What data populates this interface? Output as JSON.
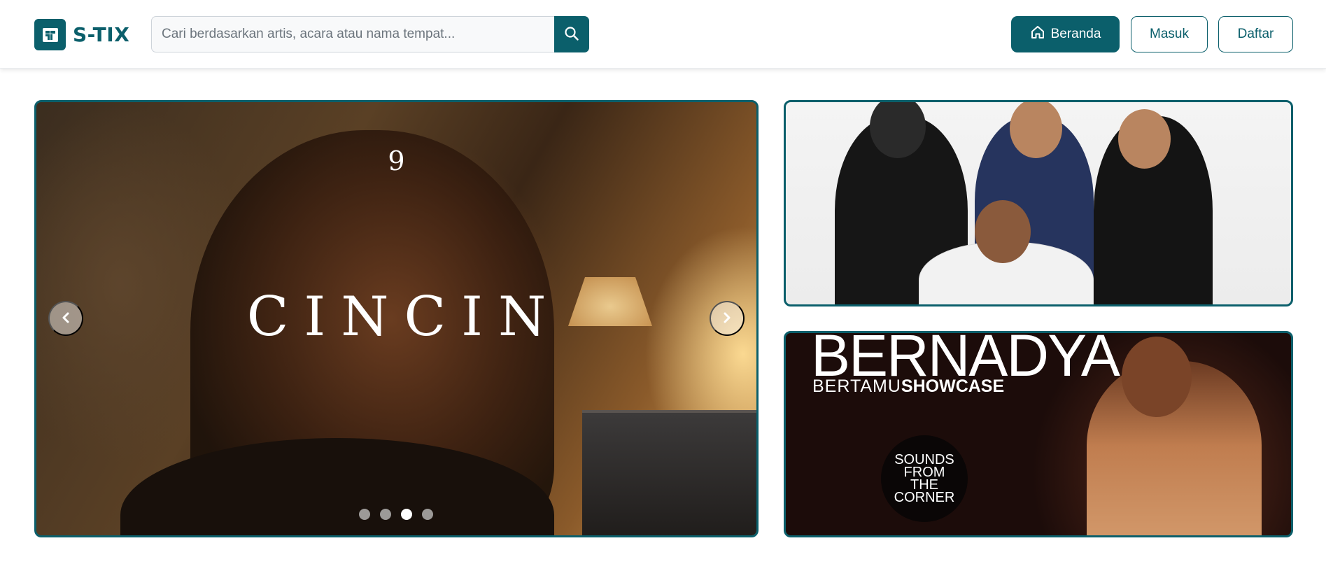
{
  "header": {
    "logo_text": "S-TIX",
    "search": {
      "placeholder": "Cari berdasarkan artis, acara atau nama tempat..."
    },
    "nav": {
      "home_label": "Beranda",
      "login_label": "Masuk",
      "register_label": "Daftar"
    }
  },
  "carousel": {
    "slide_number": "9",
    "slide_title": "CINCIN",
    "slide_count": 4,
    "active_index": 2
  },
  "side_cards": {
    "bottom": {
      "title": "BERNADYA",
      "subtitle_part1": "BERTAMU",
      "subtitle_part2": "SHOWCASE",
      "badge": "SOUNDS FROM THE CORNER"
    }
  },
  "colors": {
    "brand": "#0b5f6b",
    "background": "#ffffff"
  },
  "icons": {
    "logo": "ticket-logo-icon",
    "search": "search-icon",
    "home": "home-icon",
    "prev": "chevron-left-icon",
    "next": "chevron-right-icon"
  }
}
